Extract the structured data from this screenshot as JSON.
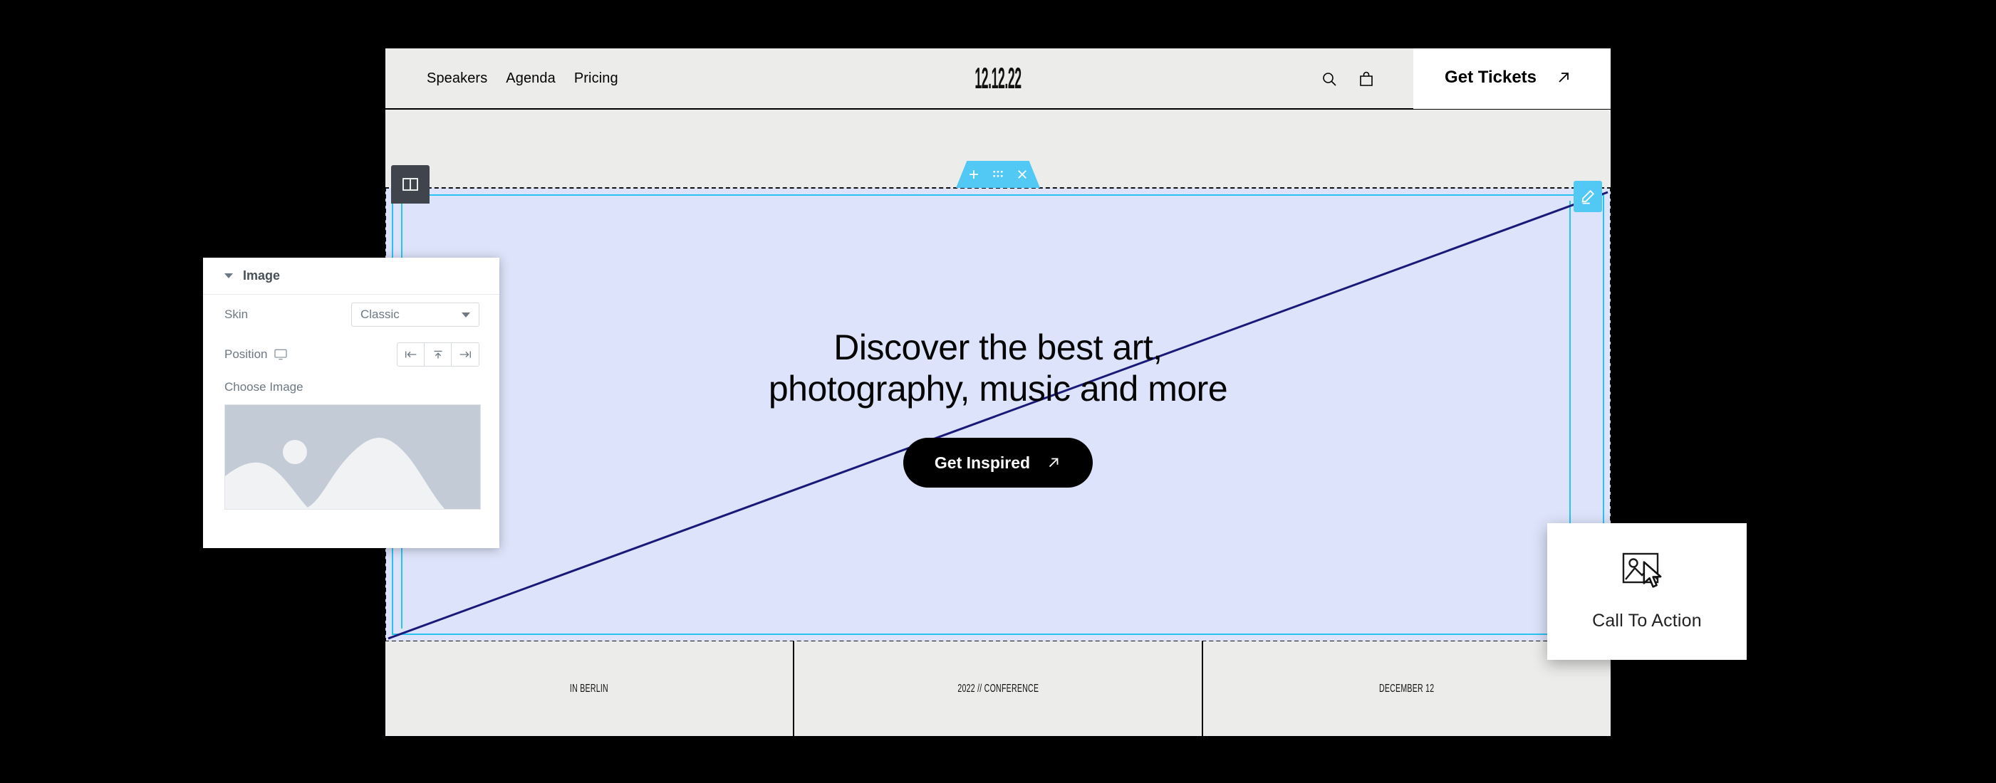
{
  "site": {
    "nav": {
      "links": [
        {
          "label": "Speakers"
        },
        {
          "label": "Agenda"
        },
        {
          "label": "Pricing"
        }
      ],
      "logo": "12.12.22",
      "search_icon": "search-icon",
      "bag_icon": "shopping-bag-icon",
      "cta": {
        "label": "Get Tickets",
        "arrow": "↗"
      }
    },
    "hero": {
      "headline": "Discover the best art,\nphotography, music and more",
      "cta": {
        "label": "Get Inspired",
        "arrow": "↗"
      }
    },
    "info_bar": {
      "cells": [
        {
          "text": "IN BERLIN"
        },
        {
          "text": "2022 // CONFERENCE"
        },
        {
          "text": "DECEMBER 12"
        }
      ]
    }
  },
  "editor": {
    "panel": {
      "title": "Image",
      "collapse_icon": "caret-down-icon",
      "skin": {
        "label": "Skin",
        "value": "Classic",
        "options": [
          "Classic"
        ],
        "dropdown_icon": "caret-down-icon"
      },
      "position": {
        "label": "Position",
        "device_icon": "desktop-icon",
        "options": [
          {
            "name": "align-left",
            "icon": "align-left-icon"
          },
          {
            "name": "align-top",
            "icon": "align-top-icon"
          },
          {
            "name": "align-right",
            "icon": "align-right-icon"
          }
        ]
      },
      "choose_image": {
        "label": "Choose Image",
        "preview_icon": "image-placeholder-graphic"
      }
    },
    "section_toolbar": {
      "add_icon": "plus-icon",
      "drag_icon": "drag-dots-icon",
      "close_icon": "close-icon"
    },
    "column_handle": {
      "icon": "columns-icon"
    },
    "edit_handle": {
      "icon": "pencil-icon"
    },
    "drag_widget": {
      "label": "Call To Action",
      "icon": "image-widget-icon",
      "cursor": "mouse-pointer-icon"
    },
    "colors": {
      "selection_fill": "#dde3fa",
      "selection_accent": "#52c8f4",
      "handle_dark": "#3f444d",
      "diagonal_line": "#19197a",
      "page_bg": "#ececea",
      "cta_bg": "#000000"
    }
  }
}
